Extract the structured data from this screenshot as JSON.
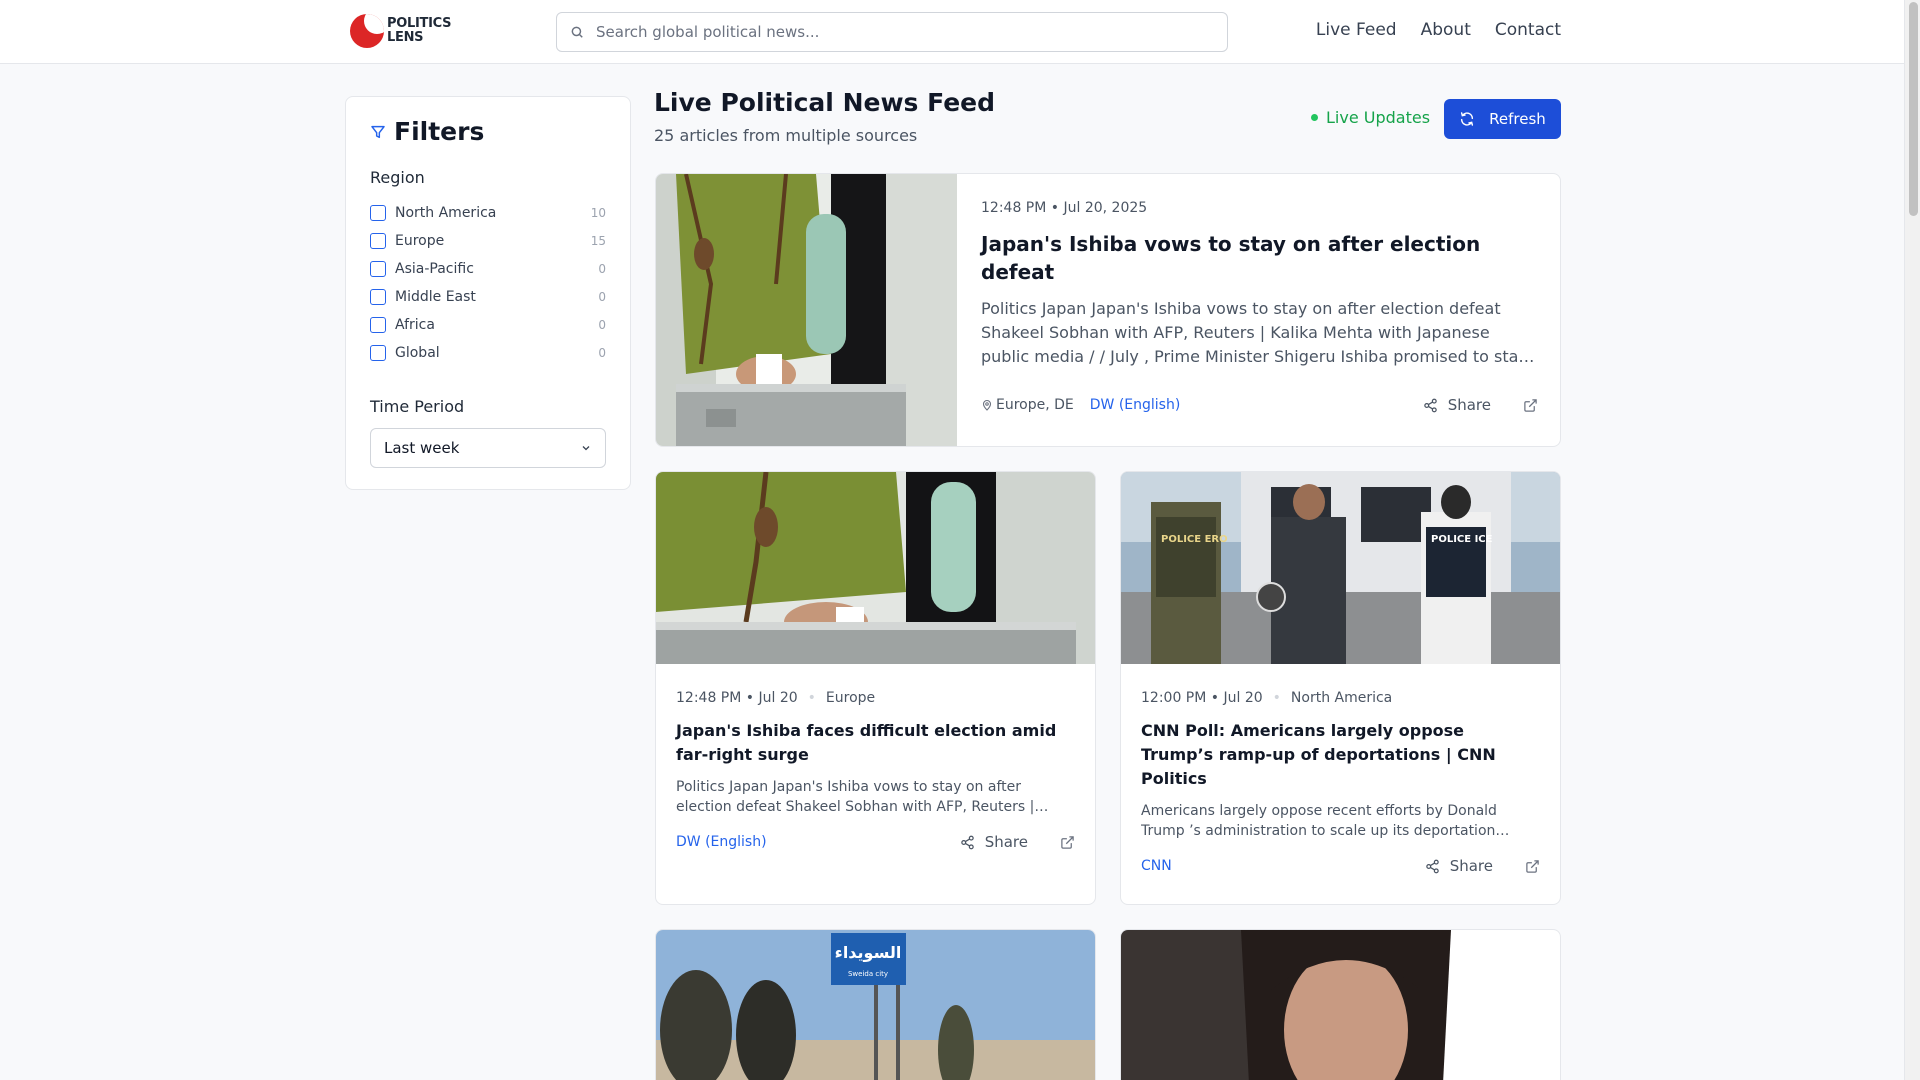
{
  "brand": {
    "line1": "POLITICS",
    "line2": "LENS"
  },
  "search": {
    "placeholder": "Search global political news..."
  },
  "nav": {
    "live_feed": "Live Feed",
    "about": "About",
    "contact": "Contact"
  },
  "filters": {
    "title": "Filters",
    "region_label": "Region",
    "regions": [
      {
        "name": "North America",
        "count": "10"
      },
      {
        "name": "Europe",
        "count": "15"
      },
      {
        "name": "Asia-Pacific",
        "count": "0"
      },
      {
        "name": "Middle East",
        "count": "0"
      },
      {
        "name": "Africa",
        "count": "0"
      },
      {
        "name": "Global",
        "count": "0"
      }
    ],
    "time_label": "Time Period",
    "time_value": "Last week"
  },
  "feed": {
    "title": "Live Political News Feed",
    "subtitle": "25 articles from multiple sources",
    "live_label": "Live Updates",
    "refresh_label": "Refresh"
  },
  "featured": {
    "time": "12:48 PM • Jul 20, 2025",
    "title": "Japan's Ishiba vows to stay on after election defeat",
    "excerpt": "Politics Japan Japan's Ishiba vows to stay on after election defeat Shakeel Sobhan with AFP, Reuters | Kalika Mehta with Japanese public media / / July , Prime Minister Shigeru Ishiba promised to stay on despite the defeat",
    "location": "Europe, DE",
    "source": "DW (English)",
    "share": "Share"
  },
  "articles": [
    {
      "time": "12:48 PM • Jul 20",
      "region": "Europe",
      "title": "Japan's Ishiba faces difficult election amid far-right surge",
      "excerpt": "Politics Japan Japan's Ishiba vows to stay on after election defeat Shakeel Sobhan with AFP, Reuters | Kalika Mehta",
      "source": "DW (English)",
      "share": "Share"
    },
    {
      "time": "12:00 PM • Jul 20",
      "region": "North America",
      "title": "CNN Poll: Americans largely oppose Trump’s ramp-up of deportations | CNN Politics",
      "excerpt": "Americans largely oppose recent efforts by Donald Trump ’s administration to scale up its deportation operations",
      "source": "CNN",
      "share": "Share"
    }
  ],
  "image_text": {
    "vest_left": "POLICE ERO",
    "vest_right": "POLICE ICE",
    "sign_arabic": "السويداء",
    "sign_latin": "Sweida city"
  },
  "colors": {
    "accent": "#1d4ed8",
    "live": "#16a34a",
    "brand_red": "#dc2626"
  }
}
